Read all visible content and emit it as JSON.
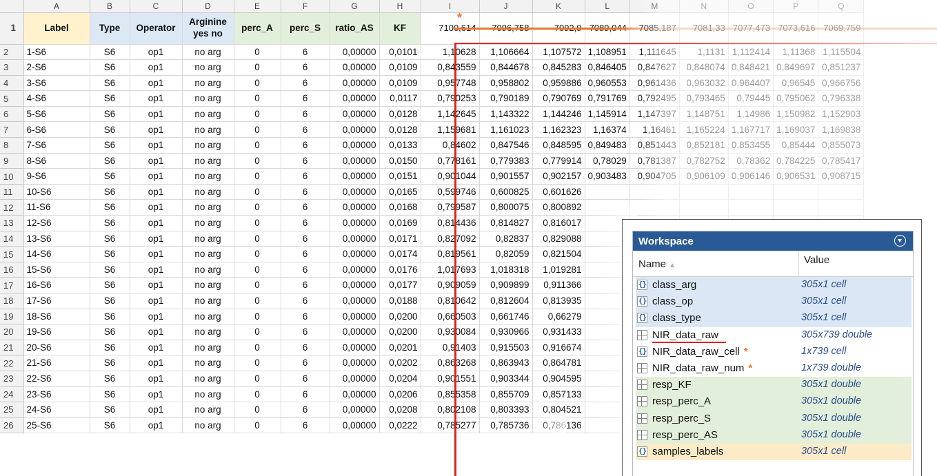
{
  "spreadsheet": {
    "columns": [
      "A",
      "B",
      "C",
      "D",
      "E",
      "F",
      "G",
      "H",
      "I",
      "J",
      "K",
      "L",
      "M",
      "N",
      "O",
      "P",
      "Q"
    ],
    "header_row_number": "1",
    "headers": [
      "Label",
      "Type",
      "Operator",
      "Arginine yes no",
      "perc_A",
      "perc_S",
      "ratio_AS",
      "KF",
      "7100,614",
      "7096,758",
      "7092,9",
      "7089,044",
      "7085,187",
      "7081,33",
      "7077,473",
      "7073,616",
      "7069,759"
    ],
    "rows": [
      [
        "2",
        "1-S6",
        "S6",
        "op1",
        "no arg",
        "0",
        "6",
        "0,00000",
        "0,0101",
        "1,10628",
        "1,106664",
        "1,107572",
        "1,108951",
        "1,111645",
        "1,1131",
        "1,112414",
        "1,11368",
        "1,115504"
      ],
      [
        "3",
        "2-S6",
        "S6",
        "op1",
        "no arg",
        "0",
        "6",
        "0,00000",
        "0,0109",
        "0,843559",
        "0,844678",
        "0,845283",
        "0,846405",
        "0,847627",
        "0,848074",
        "0,848421",
        "0,849697",
        "0,851237"
      ],
      [
        "4",
        "3-S6",
        "S6",
        "op1",
        "no arg",
        "0",
        "6",
        "0,00000",
        "0,0109",
        "0,957748",
        "0,958802",
        "0,959886",
        "0,960553",
        "0,961436",
        "0,963032",
        "0,964407",
        "0,96545",
        "0,966756"
      ],
      [
        "5",
        "4-S6",
        "S6",
        "op1",
        "no arg",
        "0",
        "6",
        "0,00000",
        "0,0117",
        "0,790253",
        "0,790189",
        "0,790769",
        "0,791769",
        "0,792495",
        "0,793465",
        "0,79445",
        "0,795062",
        "0,796338"
      ],
      [
        "6",
        "5-S6",
        "S6",
        "op1",
        "no arg",
        "0",
        "6",
        "0,00000",
        "0,0128",
        "1,142645",
        "1,143322",
        "1,144246",
        "1,145914",
        "1,147397",
        "1,148751",
        "1,14986",
        "1,150982",
        "1,152903"
      ],
      [
        "7",
        "6-S6",
        "S6",
        "op1",
        "no arg",
        "0",
        "6",
        "0,00000",
        "0,0128",
        "1,159681",
        "1,161023",
        "1,162323",
        "1,16374",
        "1,16461",
        "1,165224",
        "1,167717",
        "1,169037",
        "1,169838"
      ],
      [
        "8",
        "7-S6",
        "S6",
        "op1",
        "no arg",
        "0",
        "6",
        "0,00000",
        "0,0133",
        "0,84602",
        "0,847546",
        "0,848595",
        "0,849483",
        "0,851443",
        "0,852181",
        "0,853455",
        "0,85444",
        "0,855073"
      ],
      [
        "9",
        "8-S6",
        "S6",
        "op1",
        "no arg",
        "0",
        "6",
        "0,00000",
        "0,0150",
        "0,778161",
        "0,779383",
        "0,779914",
        "0,78029",
        "0,781387",
        "0,782752",
        "0,78362",
        "0,784225",
        "0,785417"
      ],
      [
        "10",
        "9-S6",
        "S6",
        "op1",
        "no arg",
        "0",
        "6",
        "0,00000",
        "0,0151",
        "0,901044",
        "0,901557",
        "0,902157",
        "0,903483",
        "0,904705",
        "0,906109",
        "0,906146",
        "0,906531",
        "0,908715"
      ],
      [
        "11",
        "10-S6",
        "S6",
        "op1",
        "no arg",
        "0",
        "6",
        "0,00000",
        "0,0165",
        "0,599746",
        "0,600825",
        "0,601626",
        "",
        "",
        "",
        "",
        "",
        ""
      ],
      [
        "12",
        "11-S6",
        "S6",
        "op1",
        "no arg",
        "0",
        "6",
        "0,00000",
        "0,0168",
        "0,799587",
        "0,800075",
        "0,800892",
        "",
        "",
        "",
        "",
        "",
        ""
      ],
      [
        "13",
        "12-S6",
        "S6",
        "op1",
        "no arg",
        "0",
        "6",
        "0,00000",
        "0,0169",
        "0,814436",
        "0,814827",
        "0,816017",
        "",
        "",
        "",
        "",
        "",
        ""
      ],
      [
        "14",
        "13-S6",
        "S6",
        "op1",
        "no arg",
        "0",
        "6",
        "0,00000",
        "0,0171",
        "0,827092",
        "0,82837",
        "0,829088",
        "",
        "",
        "",
        "",
        "",
        ""
      ],
      [
        "15",
        "14-S6",
        "S6",
        "op1",
        "no arg",
        "0",
        "6",
        "0,00000",
        "0,0174",
        "0,819561",
        "0,82059",
        "0,821504",
        "",
        "",
        "",
        "",
        "",
        ""
      ],
      [
        "16",
        "15-S6",
        "S6",
        "op1",
        "no arg",
        "0",
        "6",
        "0,00000",
        "0,0176",
        "1,017693",
        "1,018318",
        "1,019281",
        "",
        "",
        "",
        "",
        "",
        ""
      ],
      [
        "17",
        "16-S6",
        "S6",
        "op1",
        "no arg",
        "0",
        "6",
        "0,00000",
        "0,0177",
        "0,909059",
        "0,909899",
        "0,911366",
        "",
        "",
        "",
        "",
        "",
        ""
      ],
      [
        "18",
        "17-S6",
        "S6",
        "op1",
        "no arg",
        "0",
        "6",
        "0,00000",
        "0,0188",
        "0,810642",
        "0,812604",
        "0,813935",
        "",
        "",
        "",
        "",
        "",
        ""
      ],
      [
        "19",
        "18-S6",
        "S6",
        "op1",
        "no arg",
        "0",
        "6",
        "0,00000",
        "0,0200",
        "0,660503",
        "0,661746",
        "0,66279",
        "",
        "",
        "",
        "",
        "",
        ""
      ],
      [
        "20",
        "19-S6",
        "S6",
        "op1",
        "no arg",
        "0",
        "6",
        "0,00000",
        "0,0200",
        "0,930084",
        "0,930966",
        "0,931433",
        "",
        "",
        "",
        "",
        "",
        ""
      ],
      [
        "21",
        "20-S6",
        "S6",
        "op1",
        "no arg",
        "0",
        "6",
        "0,00000",
        "0,0201",
        "0,91403",
        "0,915503",
        "0,916674",
        "",
        "",
        "",
        "",
        "",
        ""
      ],
      [
        "22",
        "21-S6",
        "S6",
        "op1",
        "no arg",
        "0",
        "6",
        "0,00000",
        "0,0202",
        "0,863268",
        "0,863943",
        "0,864781",
        "",
        "",
        "",
        "",
        "",
        ""
      ],
      [
        "23",
        "22-S6",
        "S6",
        "op1",
        "no arg",
        "0",
        "6",
        "0,00000",
        "0,0204",
        "0,901551",
        "0,903344",
        "0,904595",
        "",
        "",
        "",
        "",
        "",
        ""
      ],
      [
        "24",
        "23-S6",
        "S6",
        "op1",
        "no arg",
        "0",
        "6",
        "0,00000",
        "0,0206",
        "0,855358",
        "0,855709",
        "0,857133",
        "",
        "",
        "",
        "",
        "",
        ""
      ],
      [
        "25",
        "24-S6",
        "S6",
        "op1",
        "no arg",
        "0",
        "6",
        "0,00000",
        "0,0208",
        "0,802108",
        "0,803393",
        "0,804521",
        "",
        "",
        "",
        "",
        "",
        ""
      ],
      [
        "26",
        "25-S6",
        "S6",
        "op1",
        "no arg",
        "0",
        "6",
        "0,00000",
        "0,0222",
        "0,785277",
        "0,785736",
        "0,786136",
        "",
        "",
        "",
        "",
        "",
        ""
      ]
    ],
    "colors": {
      "header_label_bg": "#fff2cc",
      "header_meta_bg": "#dde8f5",
      "header_response_bg": "#e2efda",
      "red_highlight": "#d9251d",
      "orange_highlight": "#e8762b"
    },
    "marker": "*"
  },
  "workspace": {
    "title": "Workspace",
    "menu_icon": "chevron-down-circle-icon",
    "col_name": "Name",
    "col_value": "Value",
    "variables": [
      {
        "name": "class_arg",
        "value": "305x1 cell",
        "icon": "cell-array-icon",
        "group": "blue",
        "star": ""
      },
      {
        "name": "class_op",
        "value": "305x1 cell",
        "icon": "cell-array-icon",
        "group": "blue",
        "star": ""
      },
      {
        "name": "class_type",
        "value": "305x1 cell",
        "icon": "cell-array-icon",
        "group": "blue",
        "star": ""
      },
      {
        "name": "NIR_data_raw",
        "value": "305x739 double",
        "icon": "matrix-icon",
        "group": "white",
        "star": ""
      },
      {
        "name": "NIR_data_raw_cell",
        "value": "1x739 cell",
        "icon": "cell-array-icon",
        "group": "white",
        "star": "*"
      },
      {
        "name": "NIR_data_raw_num",
        "value": "1x739 double",
        "icon": "matrix-icon",
        "group": "white",
        "star": "*"
      },
      {
        "name": "resp_KF",
        "value": "305x1 double",
        "icon": "matrix-icon",
        "group": "green",
        "star": ""
      },
      {
        "name": "resp_perc_A",
        "value": "305x1 double",
        "icon": "matrix-icon",
        "group": "green",
        "star": ""
      },
      {
        "name": "resp_perc_S",
        "value": "305x1 double",
        "icon": "matrix-icon",
        "group": "green",
        "star": ""
      },
      {
        "name": "resp_perc_AS",
        "value": "305x1 double",
        "icon": "matrix-icon",
        "group": "green",
        "star": ""
      },
      {
        "name": "samples_labels",
        "value": "305x1 cell",
        "icon": "cell-array-icon",
        "group": "yellow",
        "star": ""
      }
    ]
  }
}
